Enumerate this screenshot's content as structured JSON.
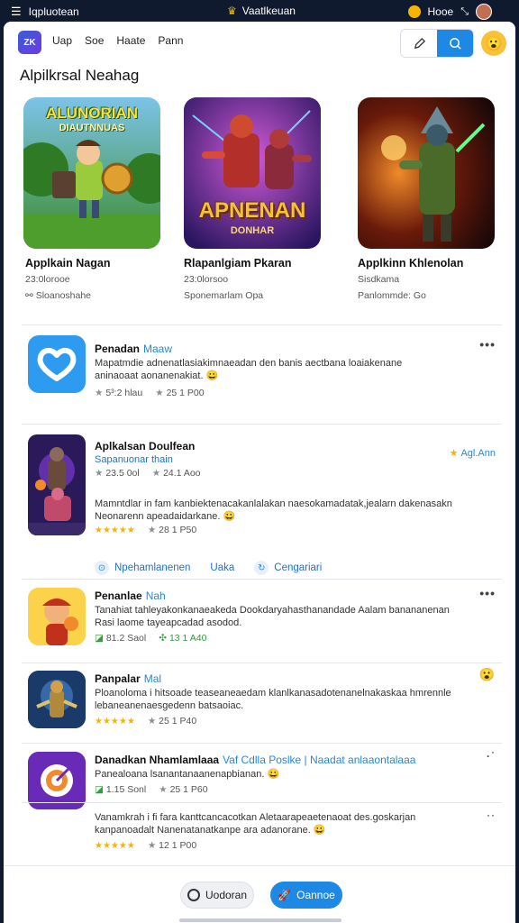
{
  "status_bar": {
    "left_icon": "menu-icon",
    "app_label": "Iqpluotean",
    "center_label": "Vaatlkeuan",
    "right_label": "Hooe",
    "colors": {
      "background": "#0f1a2e"
    }
  },
  "nav": {
    "logo_text": "ZK",
    "links": [
      "Uap",
      "Soe",
      "Haate",
      "Pann"
    ],
    "action_icons": [
      "pen-icon",
      "search-icon"
    ],
    "avatar_icon": "emoji-avatar-icon"
  },
  "section_title": "Alpilkrsal Neahag",
  "featured": [
    {
      "name": "Applkain Nagan",
      "sub": "23:0lorooe",
      "meta": "Sloanoshahe",
      "art_title": "ALUNORIAN",
      "art_sub": "DIAUTNNUAS"
    },
    {
      "name": "Rlapanlgiam Pkaran",
      "sub": "23:0lorsoo",
      "meta": "Sponemarlam Opa",
      "art_title": "APNENAN",
      "art_sub": "DONHAR"
    },
    {
      "name": "Applkinn Khlenolan",
      "sub": "Sisdkama",
      "meta": "Panlommde: Go",
      "art_title": "",
      "art_sub": ""
    }
  ],
  "apps": [
    {
      "title": "Penadan",
      "tag": "Maaw",
      "desc": "Mapatmdie adnenatlasiakimnaeadan den banis aectbana loaiakenane aninaoaat aonanenakiat. 😀",
      "rating": "5³:2 hlau",
      "downloads": "25 1 P00",
      "rating_style": "gray-star"
    },
    {
      "title": "Aplkalsan Doulfean",
      "tag": "",
      "subtitle": "Sapanuonar thain",
      "subinfo": [
        "23.5 0ol",
        "24.1 Aoo"
      ],
      "desc": "Mamntdlar in fam kanbiektenacakanlalakan naesokamadatak,jealarn dakenasakn Neonarenn apeadaidarkane. 😀",
      "stars": "★★★★★",
      "downloads": "28 1 P50",
      "featured_label": "Agl.Ann",
      "actions": [
        "Npehamlanenen",
        "Uaka",
        "Cengariari"
      ]
    },
    {
      "title": "Penanlae",
      "tag": "Nah",
      "desc": "Tanahiat tahleyakonkanaeakeda Dookdaryahasthanandade Aalam banananenan Rasi laome tayeapcadad asodod.",
      "rating": "81.2 Saol",
      "downloads": "13 1 A40",
      "rating_style": "green"
    },
    {
      "title": "Panpalar",
      "tag": "Mal",
      "desc": "Ploanoloma i hitsoade teaseaneaedam klanlkanasadotenanelnakaskaa hmrennle lebaneanenaesgedenn batsaoiac.",
      "stars": "★★★★★",
      "downloads": "25 1 P40"
    },
    {
      "title": "Danadkan Nhamlamlaaa",
      "tag": "Vaf Cdlla Poslke | Naadat anlaaontalaaa",
      "desc": "Panealoana lsanantanaanenapbianan. 😀",
      "rating": "1.15 Sonl",
      "downloads": "25 1 P60",
      "rating_style": "green",
      "more": "·˙"
    },
    {
      "title": "",
      "tag": "",
      "desc": "Vanamkrah i fi fara kanttcancacotkan Aletaarapeaetenaoat des.goskarjan kanpanoadalt Nanenatanatkanpe ara adanorane. 😀",
      "stars": "★★★★★",
      "downloads": "12 1 P00",
      "more": "˙˙"
    }
  ],
  "bottom": {
    "secondary_label": "Uodoran",
    "primary_label": "Oannoe"
  }
}
